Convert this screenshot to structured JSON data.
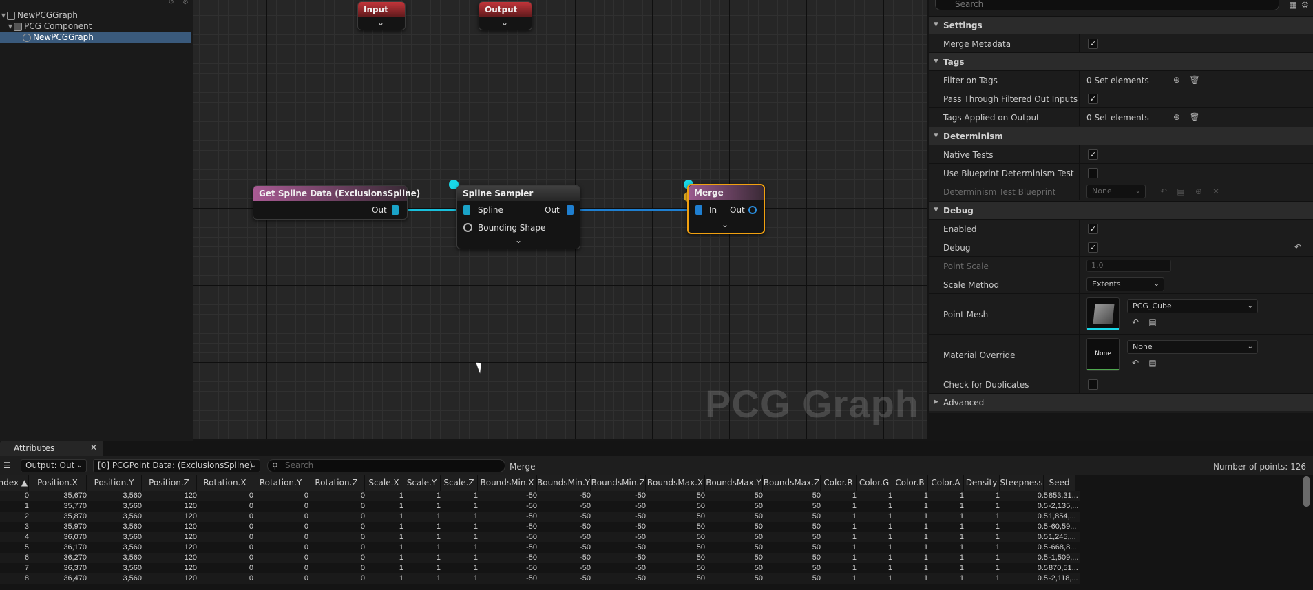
{
  "outliner": {
    "items": [
      {
        "label": "NewPCGGraph"
      },
      {
        "label": "PCG Component"
      },
      {
        "label": "NewPCGGraph"
      }
    ]
  },
  "graph": {
    "watermark": "PCG Graph",
    "nodes": {
      "input": {
        "title": "Input"
      },
      "output": {
        "title": "Output"
      },
      "get_spline": {
        "title": "Get Spline Data (ExclusionsSpline)",
        "out": "Out"
      },
      "sampler": {
        "title": "Spline Sampler",
        "in_spline": "Spline",
        "in_shape": "Bounding Shape",
        "out": "Out"
      },
      "merge": {
        "title": "Merge",
        "in": "In",
        "out": "Out"
      }
    }
  },
  "details": {
    "search_placeholder": "Search",
    "categories": {
      "settings": "Settings",
      "tags": "Tags",
      "determinism": "Determinism",
      "debug": "Debug",
      "advanced": "Advanced"
    },
    "props": {
      "merge_metadata": "Merge Metadata",
      "filter_on_tags": "Filter on Tags",
      "filter_on_tags_value": "0 Set elements",
      "pass_through": "Pass Through Filtered Out Inputs",
      "tags_applied": "Tags Applied on Output",
      "tags_applied_value": "0 Set elements",
      "native_tests": "Native Tests",
      "use_bp_test": "Use Blueprint Determinism Test",
      "det_test_bp": "Determinism Test Blueprint",
      "det_test_bp_value": "None",
      "enabled": "Enabled",
      "debug": "Debug",
      "point_scale": "Point Scale",
      "point_scale_value": "1.0",
      "scale_method": "Scale Method",
      "scale_method_value": "Extents",
      "point_mesh": "Point Mesh",
      "point_mesh_value": "PCG_Cube",
      "material_override": "Material Override",
      "material_override_value": "None",
      "material_thumb_text": "None",
      "check_duplicates": "Check for Duplicates"
    }
  },
  "attributes": {
    "tab": "Attributes",
    "output_combo": "Output: Out",
    "data_combo": "[0] PCGPoint Data: (ExclusionsSpline)",
    "search_placeholder": "Search",
    "node_name": "Merge",
    "points_count": "Number of points: 126",
    "columns": [
      "Index",
      "Position.X",
      "Position.Y",
      "Position.Z",
      "Rotation.X",
      "Rotation.Y",
      "Rotation.Z",
      "Scale.X",
      "Scale.Y",
      "Scale.Z",
      "BoundsMin.X",
      "BoundsMin.Y",
      "BoundsMin.Z",
      "BoundsMax.X",
      "BoundsMax.Y",
      "BoundsMax.Z",
      "Color.R",
      "Color.G",
      "Color.B",
      "Color.A",
      "Density",
      "Steepness",
      "Seed"
    ],
    "rows": [
      [
        "0",
        "35,670",
        "3,560",
        "120",
        "0",
        "0",
        "0",
        "1",
        "1",
        "1",
        "-50",
        "-50",
        "-50",
        "50",
        "50",
        "50",
        "1",
        "1",
        "1",
        "1",
        "1",
        "0.5",
        "853,31..."
      ],
      [
        "1",
        "35,770",
        "3,560",
        "120",
        "0",
        "0",
        "0",
        "1",
        "1",
        "1",
        "-50",
        "-50",
        "-50",
        "50",
        "50",
        "50",
        "1",
        "1",
        "1",
        "1",
        "1",
        "0.5",
        "-2,135,..."
      ],
      [
        "2",
        "35,870",
        "3,560",
        "120",
        "0",
        "0",
        "0",
        "1",
        "1",
        "1",
        "-50",
        "-50",
        "-50",
        "50",
        "50",
        "50",
        "1",
        "1",
        "1",
        "1",
        "1",
        "0.5",
        "1,854,..."
      ],
      [
        "3",
        "35,970",
        "3,560",
        "120",
        "0",
        "0",
        "0",
        "1",
        "1",
        "1",
        "-50",
        "-50",
        "-50",
        "50",
        "50",
        "50",
        "1",
        "1",
        "1",
        "1",
        "1",
        "0.5",
        "-60,59..."
      ],
      [
        "4",
        "36,070",
        "3,560",
        "120",
        "0",
        "0",
        "0",
        "1",
        "1",
        "1",
        "-50",
        "-50",
        "-50",
        "50",
        "50",
        "50",
        "1",
        "1",
        "1",
        "1",
        "1",
        "0.5",
        "1,245,..."
      ],
      [
        "5",
        "36,170",
        "3,560",
        "120",
        "0",
        "0",
        "0",
        "1",
        "1",
        "1",
        "-50",
        "-50",
        "-50",
        "50",
        "50",
        "50",
        "1",
        "1",
        "1",
        "1",
        "1",
        "0.5",
        "-668,8..."
      ],
      [
        "6",
        "36,270",
        "3,560",
        "120",
        "0",
        "0",
        "0",
        "1",
        "1",
        "1",
        "-50",
        "-50",
        "-50",
        "50",
        "50",
        "50",
        "1",
        "1",
        "1",
        "1",
        "1",
        "0.5",
        "-1,509,..."
      ],
      [
        "7",
        "36,370",
        "3,560",
        "120",
        "0",
        "0",
        "0",
        "1",
        "1",
        "1",
        "-50",
        "-50",
        "-50",
        "50",
        "50",
        "50",
        "1",
        "1",
        "1",
        "1",
        "1",
        "0.5",
        "870,51..."
      ],
      [
        "8",
        "36,470",
        "3,560",
        "120",
        "0",
        "0",
        "0",
        "1",
        "1",
        "1",
        "-50",
        "-50",
        "-50",
        "50",
        "50",
        "50",
        "1",
        "1",
        "1",
        "1",
        "1",
        "0.5",
        "-2,118,..."
      ]
    ]
  }
}
